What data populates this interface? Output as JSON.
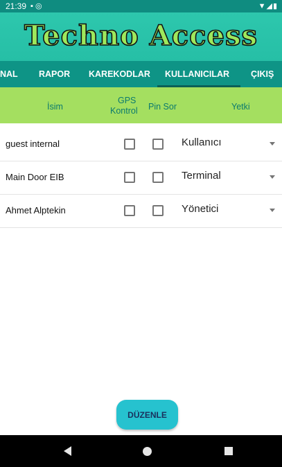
{
  "status_bar": {
    "time": "21:39",
    "left_icons": [
      "sd-card-icon",
      "sync-icon"
    ],
    "right_icons": [
      "wifi-icon",
      "signal-icon",
      "battery-icon"
    ]
  },
  "header": {
    "logo_text": "Techno Access"
  },
  "tabs": [
    {
      "label": "NAL"
    },
    {
      "label": "RAPOR"
    },
    {
      "label": "KAREKODLAR"
    },
    {
      "label": "KULLANICILAR",
      "selected": true
    },
    {
      "label": "ÇIKIŞ"
    }
  ],
  "columns": {
    "name": "İsim",
    "gps_line1": "GPS",
    "gps_line2": "Kontrol",
    "pin": "Pin Sor",
    "role": "Yetki"
  },
  "rows": [
    {
      "name": "guest internal",
      "gps": false,
      "pin": false,
      "role": "Kullanıcı"
    },
    {
      "name": "Main Door EIB",
      "gps": false,
      "pin": false,
      "role": "Terminal"
    },
    {
      "name": "Ahmet Alptekin",
      "gps": false,
      "pin": false,
      "role": "Yönetici"
    }
  ],
  "edit_button": {
    "label": "DÜZENLE"
  },
  "colors": {
    "status_bar": "#0f8c80",
    "header": "#2dc7ad",
    "tabs": "#0e9486",
    "column_header": "#a4df60",
    "button": "#26c2cf"
  }
}
